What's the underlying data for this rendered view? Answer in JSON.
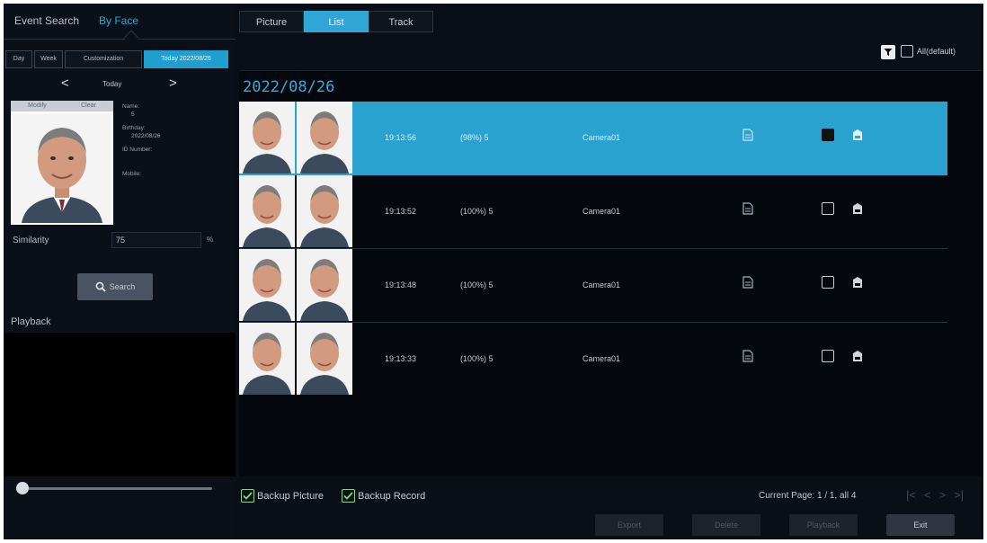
{
  "header": {
    "tabs": [
      "Event Search",
      "By Face"
    ],
    "active_tab": "By Face"
  },
  "date_tabs": [
    "Day",
    "Week",
    "Customization",
    "Today 2022/08/26"
  ],
  "day_nav": {
    "prev": "<",
    "label": "Today",
    "next": ">"
  },
  "face_card": {
    "modify_label": "Modify",
    "clear_label": "Clear"
  },
  "info": {
    "name_label": "Name:",
    "name_value": "5",
    "birthday_label": "Birthday:",
    "birthday_value": "2022/08/26",
    "id_label": "ID Number:",
    "mobile_label": "Mobile:"
  },
  "similarity": {
    "label": "Similarity",
    "value": "75",
    "unit": "%"
  },
  "search_button": "Search",
  "playback_label": "Playback",
  "view_tabs": [
    "Picture",
    "List",
    "Track"
  ],
  "active_view": "List",
  "filter": {
    "all_label": "All(default)"
  },
  "list": {
    "date": "2022/08/26",
    "rows": [
      {
        "time": "19:13:56",
        "score": "(98%) 5",
        "camera": "Camera01",
        "selected": true
      },
      {
        "time": "19:13:52",
        "score": "(100%) 5",
        "camera": "Camera01",
        "selected": false
      },
      {
        "time": "19:13:48",
        "score": "(100%) 5",
        "camera": "Camera01",
        "selected": false
      },
      {
        "time": "19:13:33",
        "score": "(100%) 5",
        "camera": "Camera01",
        "selected": false
      }
    ]
  },
  "bottom": {
    "backup_picture": "Backup Picture",
    "backup_record": "Backup Record",
    "page_info": "Current Page: 1 / 1, all 4",
    "nav": [
      "|<",
      "<",
      ">",
      ">|"
    ],
    "buttons": {
      "export": "Export",
      "delete": "Delete",
      "playback": "Playback",
      "exit": "Exit"
    }
  },
  "colors": {
    "accent": "#2fa6d6",
    "selected_row": "#2aa2cf",
    "check": "#7fd98a"
  }
}
